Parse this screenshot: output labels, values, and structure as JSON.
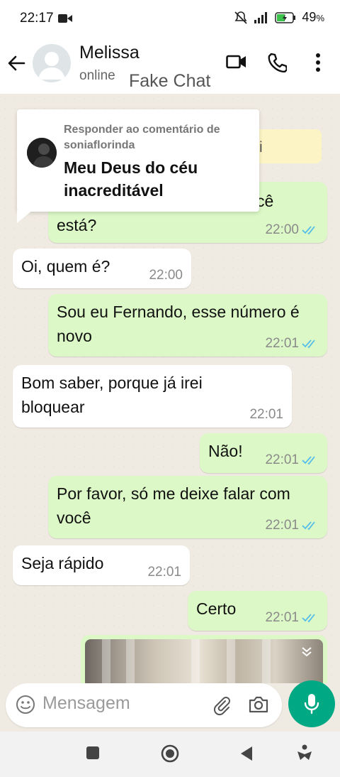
{
  "status_bar": {
    "time": "22:17",
    "battery": "49",
    "battery_unit": "%"
  },
  "header": {
    "contact_name": "Melissa",
    "status": "online",
    "watermark": "Fake Chat"
  },
  "reply_overlay": {
    "label": "Responder ao comentário de soniaflorinda",
    "text": "Meu Deus do céu inacreditável",
    "partial_behind": "i"
  },
  "messages": [
    {
      "dir": "out",
      "text": "está?",
      "partial_prefix": "cê",
      "time": "22:00",
      "read": true
    },
    {
      "dir": "in",
      "text": "Oi, quem é?",
      "time": "22:00"
    },
    {
      "dir": "out",
      "text": "Sou eu Fernando, esse número é novo",
      "time": "22:01",
      "read": true
    },
    {
      "dir": "in",
      "text": "Bom saber, porque já irei bloquear",
      "time": "22:01"
    },
    {
      "dir": "out",
      "text": "Não!",
      "time": "22:01",
      "read": true
    },
    {
      "dir": "out",
      "text": "Por favor, só me deixe falar com você",
      "time": "22:01",
      "read": true
    },
    {
      "dir": "in",
      "text": "Seja rápido",
      "time": "22:01"
    },
    {
      "dir": "out",
      "text": "Certo",
      "time": "22:01",
      "read": true
    }
  ],
  "input": {
    "placeholder": "Mensagem"
  },
  "colors": {
    "outgoing": "#dcf8c6",
    "incoming": "#ffffff",
    "accent": "#00a884",
    "read_ticks": "#53bdeb"
  },
  "icons": [
    "back-arrow-icon",
    "video-call-icon",
    "phone-icon",
    "more-vert-icon",
    "emoji-icon",
    "attach-icon",
    "camera-icon",
    "mic-icon",
    "nav-square-icon",
    "nav-circle-icon",
    "nav-back-icon",
    "nav-accessibility-icon"
  ]
}
